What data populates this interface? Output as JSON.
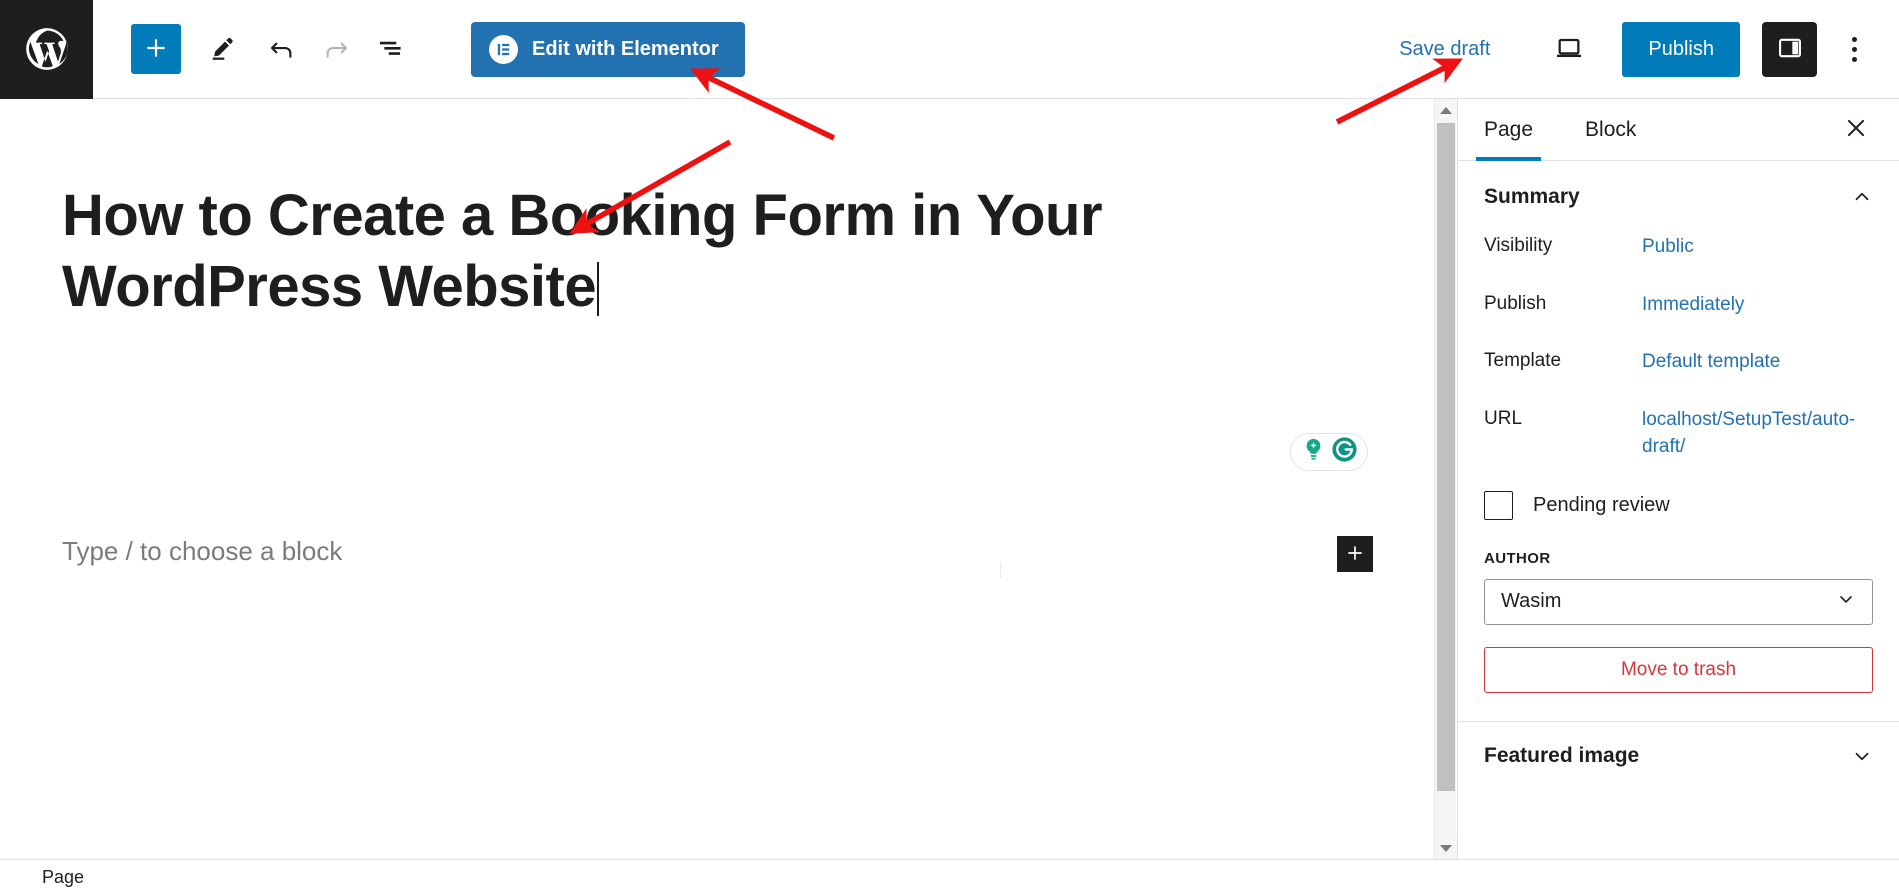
{
  "app": {
    "logo_icon": "wordpress-logo-icon"
  },
  "toolbar": {
    "add_block_icon": "plus-icon",
    "tools_icon": "pencil-icon",
    "undo_icon": "undo-arrow-icon",
    "redo_icon": "redo-arrow-icon",
    "list_view_icon": "document-overview-icon",
    "elementor_button_label": "Edit with Elementor",
    "elementor_logo_icon": "elementor-logo-icon",
    "save_draft_label": "Save draft",
    "preview_icon": "laptop-preview-icon",
    "publish_label": "Publish",
    "settings_toggle_icon": "sidebar-panel-icon",
    "more_menu_icon": "three-dots-vertical-icon"
  },
  "editor": {
    "post_title": "How to Create a Booking Form in Your WordPress Website",
    "block_placeholder": "Type / to choose a block",
    "add_block_inline_icon": "plus-icon",
    "grammarly": {
      "lightbulb_icon": "grammarly-lightbulb-icon",
      "logo_icon": "grammarly-g-icon",
      "accent_color": "#15a88a"
    }
  },
  "sidebar": {
    "tabs": [
      {
        "label": "Page",
        "active": true
      },
      {
        "label": "Block",
        "active": false
      }
    ],
    "close_icon": "close-x-icon",
    "summary": {
      "title": "Summary",
      "collapse_icon": "chevron-up-icon",
      "rows": [
        {
          "label": "Visibility",
          "value": "Public"
        },
        {
          "label": "Publish",
          "value": "Immediately"
        },
        {
          "label": "Template",
          "value": "Default template"
        },
        {
          "label": "URL",
          "value": "localhost/SetupTest/auto-draft/"
        }
      ],
      "pending_review": {
        "label": "Pending review",
        "checked": false
      },
      "author": {
        "label": "AUTHOR",
        "value": "Wasim",
        "chevron_icon": "chevron-down-icon"
      },
      "trash_label": "Move to trash"
    },
    "featured_image": {
      "title": "Featured image",
      "expand_icon": "chevron-down-icon"
    }
  },
  "status_bar": {
    "breadcrumb": "Page"
  },
  "scrollbar": {
    "up_icon": "scroll-up-arrow-icon",
    "down_icon": "scroll-down-arrow-icon"
  },
  "annotations": {
    "color": "#ee1111",
    "arrows": [
      {
        "name": "arrow-to-elementor-button",
        "target": "Edit with Elementor"
      },
      {
        "name": "arrow-to-post-title",
        "target": "post title"
      },
      {
        "name": "arrow-to-save-draft",
        "target": "Save draft"
      }
    ]
  },
  "colors": {
    "wp_blue": "#007cba",
    "elementor_blue": "#2271b1",
    "link_blue": "#2271b1",
    "danger_red": "#d63638",
    "dark": "#1e1e1e"
  }
}
